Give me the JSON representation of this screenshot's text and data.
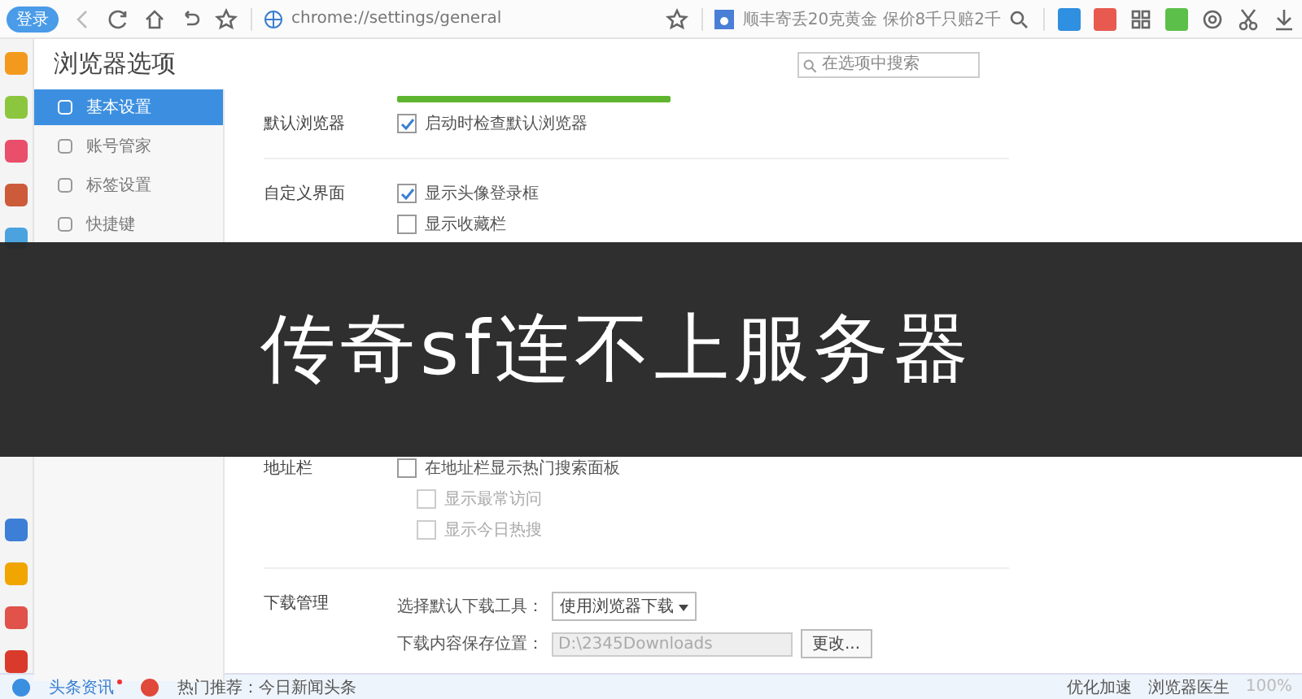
{
  "toolbar": {
    "login_button": "登录",
    "address": "chrome://settings/general",
    "news": "顺丰寄丢20克黄金 保价8千只赔2千"
  },
  "page": {
    "title": "浏览器选项",
    "search": {
      "placeholder": "在选项中搜索"
    }
  },
  "sidebar": {
    "items": [
      {
        "label": "基本设置",
        "selected": true
      },
      {
        "label": "账号管家",
        "selected": false
      },
      {
        "label": "标签设置",
        "selected": false
      },
      {
        "label": "快捷键",
        "selected": false
      }
    ]
  },
  "sections": [
    {
      "label": "默认浏览器",
      "options": [
        {
          "kind": "checkbox",
          "label": "启动时检查默认浏览器",
          "checked": true,
          "disabled": false
        }
      ]
    },
    {
      "label": "自定义界面",
      "options": [
        {
          "kind": "checkbox",
          "label": "显示头像登录框",
          "checked": true,
          "disabled": false
        },
        {
          "kind": "checkbox",
          "label": "显示收藏栏",
          "checked": false,
          "disabled": false
        }
      ]
    },
    {
      "label": "地址栏",
      "options": [
        {
          "kind": "checkbox",
          "label": "在地址栏显示热门搜索面板",
          "checked": false,
          "disabled": false
        },
        {
          "kind": "subcheckbox",
          "label": "显示最常访问",
          "checked": false,
          "disabled": true
        },
        {
          "kind": "subcheckbox",
          "label": "显示今日热搜",
          "checked": false,
          "disabled": true
        }
      ]
    },
    {
      "label": "下载管理",
      "options": [
        {
          "kind": "select",
          "label": "选择默认下载工具：",
          "value": "使用浏览器下载"
        },
        {
          "kind": "path",
          "label": "下载内容保存位置：",
          "value": "D:\\2345Downloads",
          "button": "更改..."
        }
      ]
    }
  ],
  "banner": {
    "text": "传奇sf连不上服务器"
  },
  "status_bar": {
    "left": [
      "头条资讯",
      "热门推荐：今日新闻头条"
    ],
    "right": [
      "优化加速",
      "浏览器医生"
    ],
    "zoom": "100%"
  }
}
